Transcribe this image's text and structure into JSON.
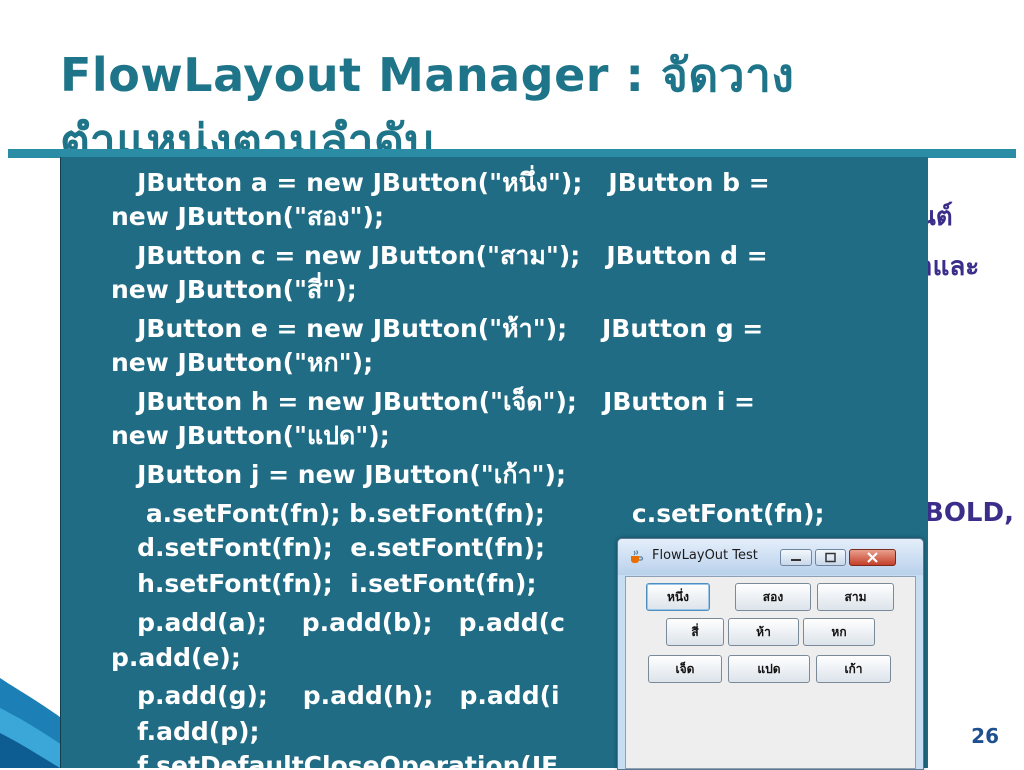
{
  "slide": {
    "title_line1": "FlowLayout Manager : จัดวาง",
    "title_line2": "ตำแหน่งตามลำดับ",
    "bg_text_1": "นต์",
    "bg_text_2": "าและ",
    "bg_text_3": "BOLD,",
    "page_number": "26"
  },
  "code_lines": [
    "   JButton a = new JButton(\"หนึ่ง\");   JButton b =",
    "new JButton(\"สอง\");",
    "   JButton c = new JButton(\"สาม\");   JButton d =",
    "new JButton(\"สี่\");",
    "   JButton e = new JButton(\"ห้า\");    JButton g =",
    "new JButton(\"หก\");",
    "   JButton h = new JButton(\"เจ็ด\");   JButton i =",
    "new JButton(\"แปด\");",
    "   JButton j = new JButton(\"เก้า\");",
    "    a.setFont(fn); b.setFont(fn);          c.setFont(fn);",
    "   d.setFont(fn);  e.setFont(fn);",
    "   h.setFont(fn);  i.setFont(fn);",
    "   p.add(a);    p.add(b);   p.add(c",
    "p.add(e);",
    "   p.add(g);    p.add(h);   p.add(i",
    "   f.add(p);",
    "   f.setDefaultCloseOperation(JF        EXIT_ON_CL"
  ],
  "java_window": {
    "title": "FlowLayOut Test",
    "buttons": [
      "หนึ่ง",
      "สอง",
      "สาม",
      "สี่",
      "ห้า",
      "หก",
      "เจ็ด",
      "แปด",
      "เก้า"
    ]
  },
  "icons": {
    "app": "java-cup-icon",
    "minimize": "minimize-icon",
    "maximize": "maximize-icon",
    "close": "close-icon"
  },
  "colors": {
    "title": "#1e7488",
    "code_background": "#1f6c84",
    "code_text": "#ffffff",
    "accent_text": "#3a2e8a",
    "window_frame": "#c7ddf2",
    "close_button": "#c4402a"
  }
}
